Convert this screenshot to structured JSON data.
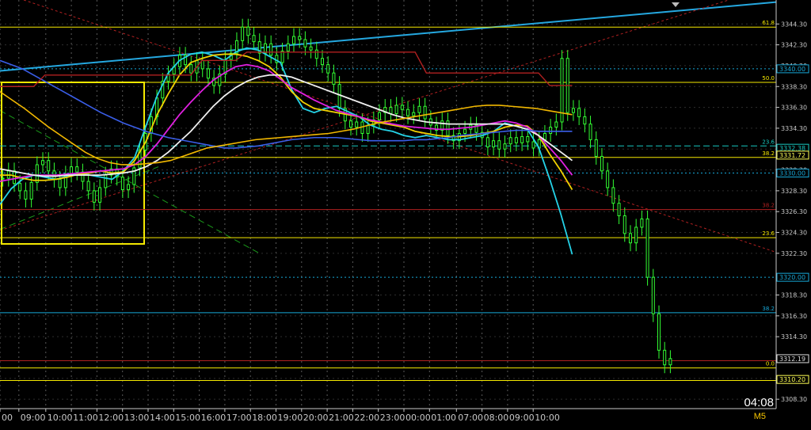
{
  "chart_data": {
    "type": "candlestick",
    "symbol_timeframe": "M5",
    "countdown": "04:08",
    "ylim": [
      3307.4,
      3346.6
    ],
    "xlim": [
      0,
      1000
    ],
    "price_ticks": [
      "3344.30",
      "3342.30",
      "3340.30",
      "3338.30",
      "3336.30",
      "3334.30",
      "3332.30",
      "3330.30",
      "3328.30",
      "3326.30",
      "3324.30",
      "3322.30",
      "3318.30",
      "3316.30",
      "3314.30",
      "3310.30",
      "3308.30"
    ],
    "time_labels": [
      {
        "t": 0,
        "label": "00"
      },
      {
        "t": 28,
        "label": "09:00"
      },
      {
        "t": 68,
        "label": "10:00"
      },
      {
        "t": 106,
        "label": "11:00"
      },
      {
        "t": 144,
        "label": "12:00"
      },
      {
        "t": 182,
        "label": "13:00"
      },
      {
        "t": 220,
        "label": "14:00"
      },
      {
        "t": 258,
        "label": "15:00"
      },
      {
        "t": 296,
        "label": "16:00"
      },
      {
        "t": 334,
        "label": "17:00"
      },
      {
        "t": 372,
        "label": "18:00"
      },
      {
        "t": 410,
        "label": "19:00"
      },
      {
        "t": 448,
        "label": "20:00"
      },
      {
        "t": 486,
        "label": "21:00"
      },
      {
        "t": 524,
        "label": "22:00"
      },
      {
        "t": 562,
        "label": "23:00"
      },
      {
        "t": 600,
        "label": "00:00"
      },
      {
        "t": 638,
        "label": "01:00"
      },
      {
        "t": 678,
        "label": "07:00"
      },
      {
        "t": 716,
        "label": "08:00"
      },
      {
        "t": 754,
        "label": "09:00"
      },
      {
        "t": 792,
        "label": "10:00"
      }
    ],
    "price_tags": [
      {
        "price": 3340.0,
        "label": "3340.00",
        "color": "#17a8d8"
      },
      {
        "price": 3332.38,
        "label": "3332.38",
        "color": "#17c8c0"
      },
      {
        "price": 3331.72,
        "label": "3331.72",
        "color": "#ffff55"
      },
      {
        "price": 3330.0,
        "label": "3330.00",
        "color": "#17a8d8"
      },
      {
        "price": 3320.0,
        "label": "3320.00",
        "color": "#17a8d8"
      },
      {
        "price": 3312.19,
        "label": "3312.19",
        "color": "#dddddd"
      },
      {
        "price": 3310.2,
        "label": "3310.20",
        "color": "#ffff55"
      }
    ],
    "levels": [
      {
        "price": 3344.0,
        "color": "#f5e900",
        "label": "61.8"
      },
      {
        "price": 3338.7,
        "color": "#f5e900",
        "label": "50.0"
      },
      {
        "price": 3332.6,
        "color": "#17c8c0",
        "label": "23.6",
        "dash": "8,4"
      },
      {
        "price": 3331.5,
        "color": "#f5e900",
        "label": "38.2"
      },
      {
        "price": 3326.5,
        "color": "#b02020",
        "label": "38.2"
      },
      {
        "price": 3323.8,
        "color": "#f5e900",
        "label": "23.6"
      },
      {
        "price": 3316.6,
        "color": "#17a8d8",
        "label": "38.2"
      },
      {
        "price": 3312.0,
        "color": "#b02020",
        "label": ""
      },
      {
        "price": 3311.3,
        "color": "#f5e900",
        "label": "0.0"
      },
      {
        "price": 3310.1,
        "color": "#f5e900",
        "label": ""
      },
      {
        "price": 3330.0,
        "color": "#17a8d8",
        "label": "",
        "dash": "2,3"
      },
      {
        "price": 3320.0,
        "color": "#17a8d8",
        "label": "",
        "dash": "2,3"
      },
      {
        "price": 3340.0,
        "color": "#17a8d8",
        "label": "",
        "dash": "2,3"
      }
    ],
    "candles_close": [
      3329.5,
      3330.2,
      3329.0,
      3328.3,
      3327.5,
      3329.1,
      3330.8,
      3331.2,
      3330.2,
      3329.4,
      3328.6,
      3329.9,
      3330.6,
      3330.1,
      3329.2,
      3328.3,
      3327.2,
      3328.6,
      3329.8,
      3330.4,
      3329.6,
      3328.4,
      3328.9,
      3330.5,
      3332.2,
      3333.8,
      3335.4,
      3337.2,
      3338.8,
      3339.5,
      3340.2,
      3341.3,
      3340.4,
      3339.6,
      3340.8,
      3340.0,
      3339.1,
      3338.4,
      3339.5,
      3340.9,
      3341.5,
      3342.7,
      3344.0,
      3343.2,
      3342.6,
      3341.5,
      3342.4,
      3341.3,
      3340.6,
      3341.7,
      3342.4,
      3343.1,
      3342.8,
      3342.1,
      3341.8,
      3341.0,
      3340.4,
      3339.6,
      3338.5,
      3336.2,
      3335.0,
      3334.4,
      3334.9,
      3333.8,
      3334.6,
      3335.1,
      3335.8,
      3336.3,
      3335.7,
      3336.5,
      3336.1,
      3335.5,
      3335.8,
      3336.4,
      3335.2,
      3334.6,
      3334.1,
      3335.0,
      3333.6,
      3333.1,
      3333.8,
      3334.2,
      3334.6,
      3333.9,
      3333.4,
      3332.5,
      3333.1,
      3332.3,
      3332.8,
      3333.4,
      3332.9,
      3333.5,
      3333.0,
      3332.4,
      3333.2,
      3333.8,
      3334.4,
      3334.9,
      3341.0,
      3335.8,
      3336.2,
      3335.4,
      3334.7,
      3333.2,
      3331.6,
      3330.2,
      3328.6,
      3327.1,
      3325.9,
      3324.2,
      3323.3,
      3324.8,
      3325.6,
      3320.0,
      3316.5,
      3313.0,
      3311.6,
      3312.2
    ],
    "series": [
      {
        "name": "ma-cyan",
        "color": "#25d3e8",
        "width": 1.8,
        "values": [
          3327.0,
          3328.5,
          3329.4,
          3329.8,
          3329.6,
          3329.4,
          3329.7,
          3330.0,
          3329.8,
          3329.6,
          3329.4,
          3330.2,
          3331.5,
          3334.5,
          3337.4,
          3339.6,
          3340.8,
          3341.4,
          3341.6,
          3341.3,
          3340.8,
          3341.6,
          3342.0,
          3341.8,
          3341.2,
          3340.6,
          3338.0,
          3336.2,
          3335.8,
          3336.2,
          3336.4,
          3335.9,
          3335.4,
          3334.6,
          3334.2,
          3334.0,
          3333.6,
          3333.4,
          3333.6,
          3333.4,
          3333.2,
          3333.2,
          3333.4,
          3333.6,
          3334.0,
          3334.8,
          3334.5,
          3334.2,
          3332.5,
          3329.4,
          3326.0,
          3322.2
        ]
      },
      {
        "name": "ma-yellow",
        "color": "#f2d200",
        "width": 1.8,
        "values": [
          3329.8,
          3329.8,
          3329.5,
          3329.3,
          3329.3,
          3329.4,
          3329.6,
          3329.9,
          3330.0,
          3330.2,
          3330.0,
          3330.1,
          3331.2,
          3333.0,
          3335.6,
          3337.6,
          3339.4,
          3340.6,
          3341.0,
          3341.3,
          3341.4,
          3341.4,
          3341.2,
          3340.8,
          3340.2,
          3339.2,
          3337.8,
          3336.8,
          3336.2,
          3336.0,
          3335.8,
          3335.6,
          3335.4,
          3335.0,
          3334.8,
          3334.6,
          3334.4,
          3334.0,
          3333.8,
          3333.6,
          3333.5,
          3333.5,
          3333.6,
          3333.8,
          3334.0,
          3334.4,
          3334.6,
          3334.5,
          3333.6,
          3331.8,
          3330.2,
          3328.4
        ]
      },
      {
        "name": "ma-magenta",
        "color": "#e020e0",
        "width": 1.8,
        "values": [
          3329.2,
          3329.4,
          3329.6,
          3329.8,
          3329.8,
          3329.8,
          3329.9,
          3330.0,
          3330.1,
          3330.2,
          3330.3,
          3330.4,
          3330.8,
          3331.6,
          3332.8,
          3334.2,
          3335.6,
          3336.8,
          3337.9,
          3338.9,
          3339.6,
          3340.2,
          3340.4,
          3340.2,
          3339.8,
          3339.0,
          3338.2,
          3337.6,
          3337.0,
          3336.5,
          3336.0,
          3335.7,
          3335.4,
          3335.1,
          3334.9,
          3334.7,
          3334.5,
          3334.4,
          3334.3,
          3334.2,
          3334.2,
          3334.3,
          3334.4,
          3334.6,
          3334.8,
          3335.0,
          3334.8,
          3334.4,
          3333.6,
          3332.4,
          3331.2,
          3329.8
        ]
      },
      {
        "name": "ma-white",
        "color": "#f0f0f0",
        "width": 1.8,
        "values": [
          3330.4,
          3330.2,
          3330.0,
          3329.8,
          3329.7,
          3329.7,
          3329.8,
          3329.8,
          3329.8,
          3329.8,
          3329.9,
          3330.0,
          3330.2,
          3330.6,
          3331.2,
          3332.0,
          3333.0,
          3334.0,
          3335.2,
          3336.4,
          3337.4,
          3338.2,
          3338.8,
          3339.2,
          3339.4,
          3339.4,
          3339.2,
          3338.8,
          3338.4,
          3338.0,
          3337.6,
          3337.2,
          3336.8,
          3336.4,
          3336.0,
          3335.6,
          3335.3,
          3335.1,
          3334.9,
          3334.8,
          3334.7,
          3334.7,
          3334.7,
          3334.7,
          3334.7,
          3334.7,
          3334.5,
          3334.2,
          3333.6,
          3332.8,
          3332.0,
          3331.2
        ]
      },
      {
        "name": "ma-blue",
        "color": "#3a5ee8",
        "width": 1.6,
        "values": [
          3340.8,
          3340.4,
          3340.0,
          3339.4,
          3338.8,
          3338.2,
          3337.6,
          3337.0,
          3336.4,
          3335.8,
          3335.3,
          3334.8,
          3334.4,
          3334.0,
          3333.7,
          3333.4,
          3333.2,
          3333.0,
          3332.8,
          3332.6,
          3332.4,
          3332.4,
          3332.5,
          3332.6,
          3332.8,
          3333.0,
          3333.2,
          3333.3,
          3333.4,
          3333.4,
          3333.4,
          3333.3,
          3333.2,
          3333.1,
          3333.1,
          3333.1,
          3333.1,
          3333.2,
          3333.2,
          3333.3,
          3333.4,
          3333.6,
          3333.7,
          3333.8,
          3333.9,
          3334.0,
          3334.1,
          3334.1,
          3334.0,
          3334.0,
          3334.0,
          3334.0
        ]
      },
      {
        "name": "ma-orange",
        "color": "#f2b800",
        "width": 1.6,
        "values": [
          3337.8,
          3337.0,
          3336.2,
          3335.3,
          3334.4,
          3333.6,
          3332.8,
          3332.0,
          3331.4,
          3331.0,
          3330.8,
          3330.8,
          3330.9,
          3331.0,
          3331.2,
          3331.6,
          3332.0,
          3332.4,
          3332.6,
          3332.8,
          3333.0,
          3333.2,
          3333.3,
          3333.4,
          3333.5,
          3333.6,
          3333.7,
          3333.8,
          3334.0,
          3334.2,
          3334.5,
          3334.8,
          3335.0,
          3335.2,
          3335.4,
          3335.6,
          3335.8,
          3336.0,
          3336.2,
          3336.4,
          3336.5,
          3336.5,
          3336.4,
          3336.3,
          3336.2,
          3336.0,
          3335.8,
          3335.6
        ]
      },
      {
        "name": "ma-darkred",
        "color": "#b02020",
        "width": 1.4,
        "values": [
          3338.3,
          3338.3,
          3338.3,
          3338.3,
          3339.4,
          3339.4,
          3339.4,
          3339.4,
          3339.4,
          3339.4,
          3339.4,
          3339.4,
          3339.4,
          3339.4,
          3339.4,
          3339.4,
          3339.4,
          3339.4,
          3340.8,
          3340.8,
          3340.8,
          3340.8,
          3341.6,
          3341.6,
          3341.6,
          3341.6,
          3341.6,
          3341.6,
          3341.6,
          3341.6,
          3341.6,
          3341.6,
          3341.6,
          3341.6,
          3341.6,
          3341.6,
          3341.6,
          3341.6,
          3339.6,
          3339.6,
          3339.6,
          3339.6,
          3339.6,
          3339.6,
          3339.6,
          3339.6,
          3339.6,
          3339.6,
          3339.6,
          3338.4,
          3338.4,
          3338.4
        ]
      }
    ]
  }
}
